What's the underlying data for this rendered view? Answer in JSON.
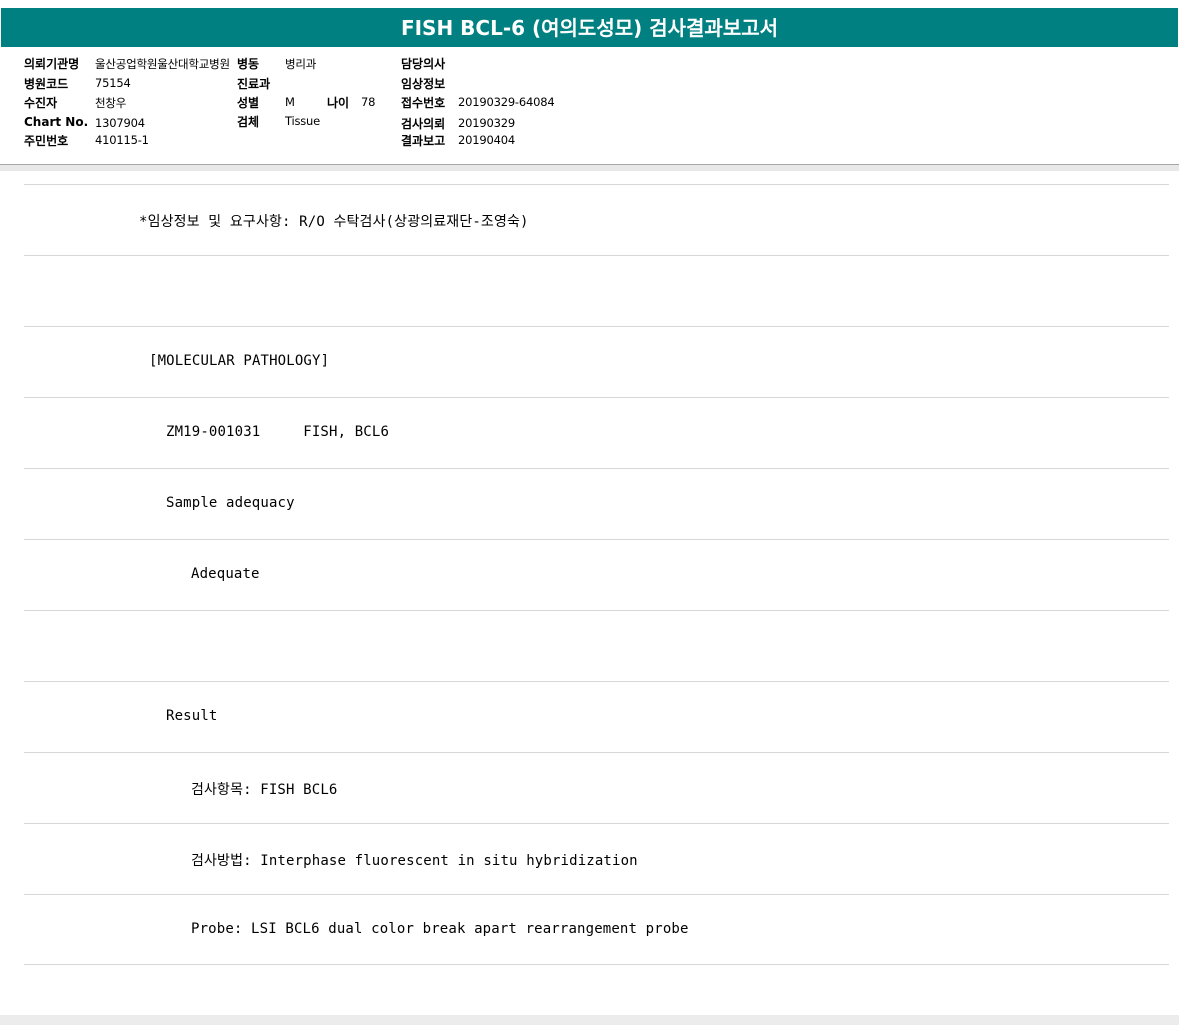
{
  "title": "FISH BCL-6 (여의도성모) 검사결과보고서",
  "header": {
    "institution_label": "의뢰기관명",
    "institution_value": "울산공업학원울산대학교병원",
    "ward_label": "병동",
    "ward_value": "병리과",
    "doctor_label": "담당의사",
    "doctor_value": "",
    "hospital_code_label": "병원코드",
    "hospital_code_value": "75154",
    "dept_label": "진료과",
    "dept_value": "",
    "clinical_info_label": "임상정보",
    "clinical_info_value": "",
    "patient_label": "수진자",
    "patient_value": "천창우",
    "sex_label": "성별",
    "sex_value": "M",
    "age_label": "나이",
    "age_value": "78",
    "receipt_no_label": "접수번호",
    "receipt_no_value": "20190329-64084",
    "chart_no_label": "Chart No.",
    "chart_no_value": "1307904",
    "specimen_label": "검체",
    "specimen_value": "Tissue",
    "request_date_label": "검사의뢰",
    "request_date_value": "20190329",
    "resident_no_label": "주민번호",
    "resident_no_value": "410115-1",
    "report_date_label": "결과보고",
    "report_date_value": "20190404"
  },
  "report_lines": [
    "*임상정보 및 요구사항: R/O 수탁검사(상광의료재단-조영숙)",
    "",
    "[MOLECULAR PATHOLOGY]",
    "ZM19-001031     FISH, BCL6",
    "Sample adequacy",
    "Adequate",
    "",
    "Result",
    "검사항목: FISH BCL6",
    "검사방법: Interphase fluorescent in situ hybridization",
    "Probe: LSI BCL6 dual color break apart rearrangement probe"
  ]
}
